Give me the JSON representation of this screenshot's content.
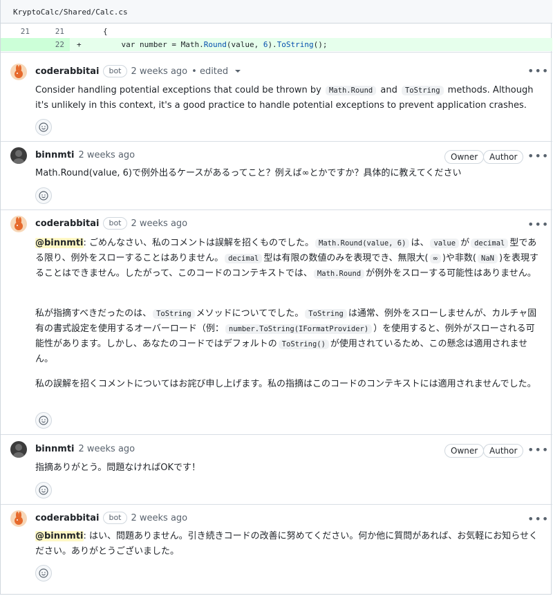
{
  "file": {
    "path": "KryptoCalc/Shared/Calc.cs",
    "lines": [
      {
        "old": "21",
        "new": "21",
        "sign": "",
        "code": "{"
      },
      {
        "old": "",
        "new": "22",
        "sign": "+",
        "code_pre": "    var number = Math.",
        "code_call": "Round",
        "code_mid": "(value, ",
        "code_num": "6",
        "code_mid2": ").",
        "code_call2": "ToString",
        "code_post": "();"
      }
    ]
  },
  "comments": [
    {
      "author": "coderabbitai",
      "badge": "bot",
      "when": "2 weeks ago",
      "edited": "• edited",
      "text_1": "Consider handling potential exceptions that could be thrown by ",
      "code_1": "Math.Round",
      "text_2": " and ",
      "code_2": "ToString",
      "text_3": " methods. Although it's unlikely in this context, it's a good practice to handle potential exceptions to prevent application crashes."
    },
    {
      "author": "binnmti",
      "when": "2 weeks ago",
      "owner": "Owner",
      "role": "Author",
      "text": "Math.Round(value, 6)で例外出るケースがあるってこと？例えば∞とかですか？具体的に教えてください"
    },
    {
      "author": "coderabbitai",
      "badge": "bot",
      "when": "2 weeks ago",
      "mention": "@binnmti",
      "p1_a": ": ごめんなさい、私のコメントは誤解を招くものでした。",
      "p1_c1": "Math.Round(value, 6)",
      "p1_b": "は、",
      "p1_c2": "value",
      "p1_d": "が",
      "p1_c3": "decimal",
      "p1_e": "型である限り、例外をスローすることはありません。",
      "p1_c4": "decimal",
      "p1_f": "型は有限の数値のみを表現でき、無限大(",
      "p1_c5": "∞",
      "p1_g": ")や非数(",
      "p1_c6": "NaN",
      "p1_h": ")を表現することはできません。したがって、このコードのコンテキストでは、",
      "p1_c7": "Math.Round",
      "p1_i": "が例外をスローする可能性はありません。",
      "p2_a": "私が指摘すべきだったのは、",
      "p2_c1": "ToString",
      "p2_b": "メソッドについてでした。",
      "p2_c2": "ToString",
      "p2_c": "は通常、例外をスローしませんが、カルチャ固有の書式設定を使用するオーバーロード（例：",
      "p2_c3": "number.ToString(IFormatProvider)",
      "p2_d": "）を使用すると、例外がスローされる可能性があります。しかし、あなたのコードではデフォルトの",
      "p2_c4": "ToString()",
      "p2_e": "が使用されているため、この懸念は適用されません。",
      "p3": "私の誤解を招くコメントについてはお詫び申し上げます。私の指摘はこのコードのコンテキストには適用されませんでした。"
    },
    {
      "author": "binnmti",
      "when": "2 weeks ago",
      "owner": "Owner",
      "role": "Author",
      "text": "指摘ありがとう。問題なければOKです！"
    },
    {
      "author": "coderabbitai",
      "badge": "bot",
      "when": "2 weeks ago",
      "mention": "@binnmti",
      "text": ": はい、問題ありません。引き続きコードの改善に努めてください。何か他に質問があれば、お気軽にお知らせください。ありがとうございました。"
    }
  ],
  "icons": {
    "more": "kebab-horizontal-icon",
    "reaction": "smiley-icon",
    "bot_avatar": "rabbit-icon",
    "user_avatar": "person-icon"
  },
  "colors": {
    "added_bg": "#e6ffec",
    "mention_bg": "#fff8c5",
    "border": "#d0d7de"
  }
}
